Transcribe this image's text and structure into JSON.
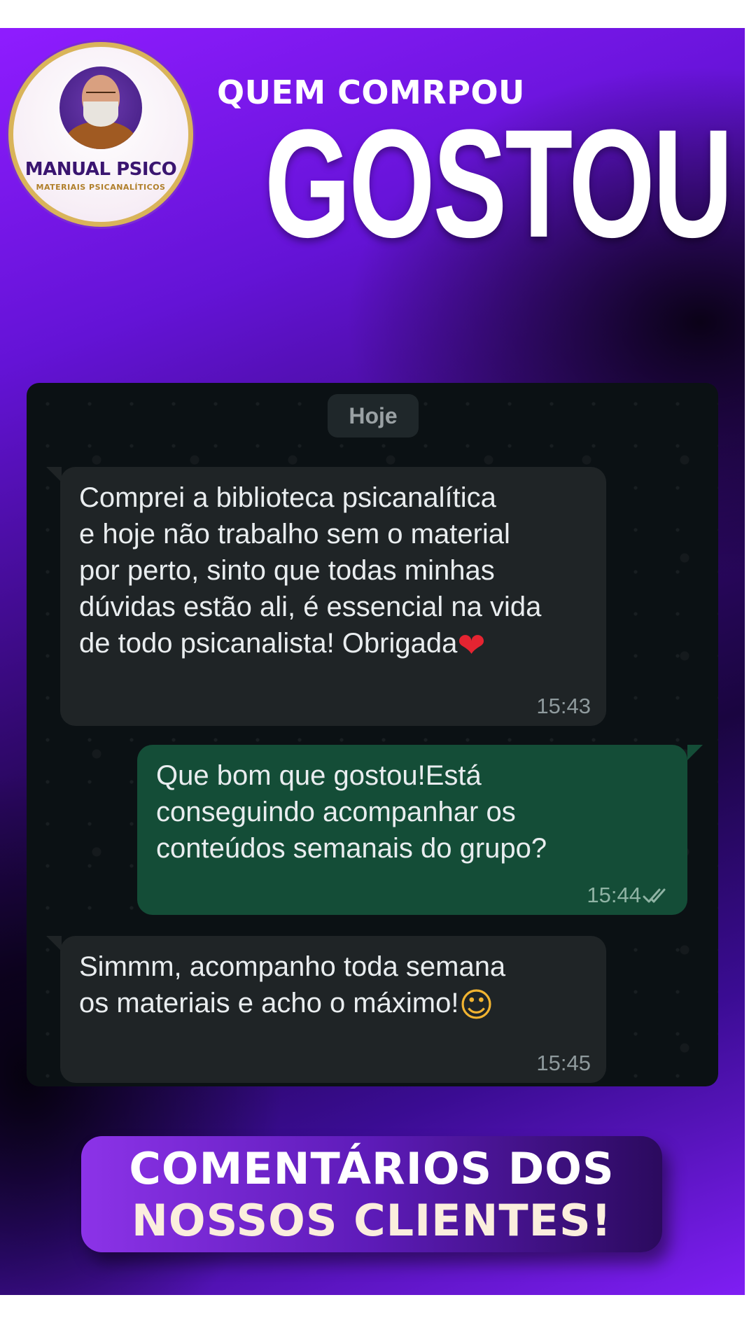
{
  "logo": {
    "title": "MANUAL PSICO",
    "subtitle": "MATERIAIS PSICANALÍTICOS"
  },
  "headline": {
    "top": "QUEM COMRPOU",
    "main": "GOSTOU"
  },
  "chat": {
    "date_chip": "Hoje",
    "messages": [
      {
        "direction": "incoming",
        "text": "Comprei a biblioteca psicanalítica\ne hoje não trabalho sem o material\npor perto, sinto que todas minhas\ndúvidas estão ali, é essencial na vida\nde todo psicanalista! Obrigada",
        "emoji": "❤",
        "time": "15:43"
      },
      {
        "direction": "outgoing",
        "text": "Que bom que gostou!Está\nconseguindo acompanhar os\nconteúdos semanais do grupo?",
        "time": "15:44",
        "status_icon": "double-check-icon"
      },
      {
        "direction": "incoming",
        "text": "Simmm, acompanho toda semana\nos materiais e acho o máximo!",
        "emoji": "☺",
        "time": "15:45"
      }
    ]
  },
  "cta": {
    "line1": "COMENTÁRIOS DOS",
    "line2": "NOSSOS CLIENTES!"
  },
  "colors": {
    "incoming_bubble": "#1f2426",
    "outgoing_bubble": "#144d37",
    "accent_purple": "#8f1cff"
  }
}
